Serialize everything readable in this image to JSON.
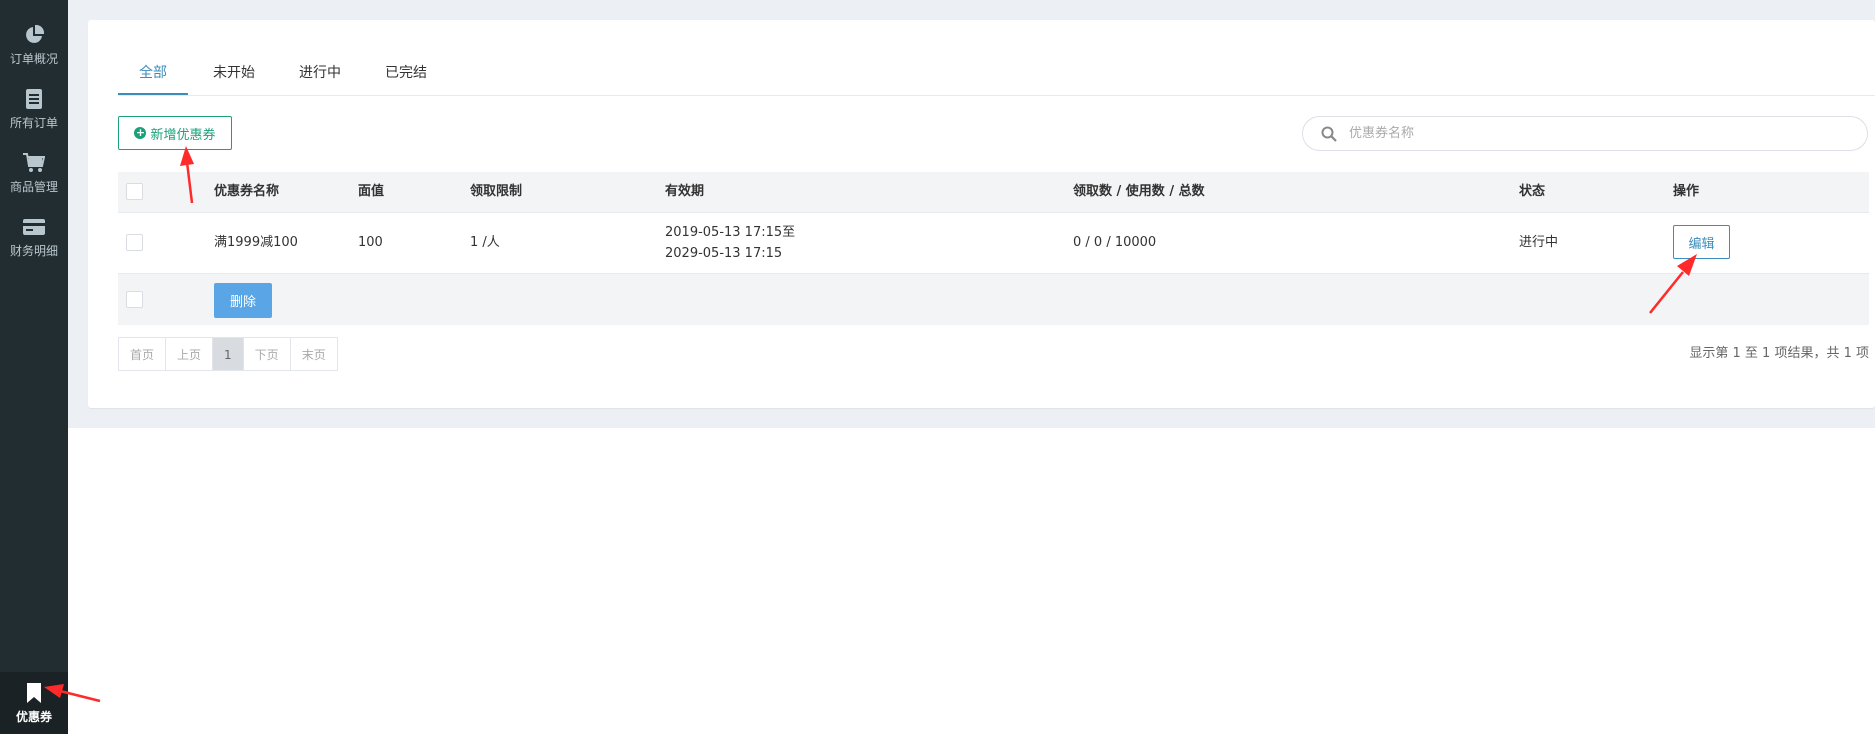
{
  "sidebar": {
    "items": [
      {
        "label": "订单概况",
        "icon": "pie-chart-icon"
      },
      {
        "label": "所有订单",
        "icon": "document-icon"
      },
      {
        "label": "商品管理",
        "icon": "cart-icon"
      },
      {
        "label": "财务明细",
        "icon": "credit-card-icon"
      },
      {
        "label": "优惠券",
        "icon": "bookmark-icon"
      }
    ],
    "active": "优惠券"
  },
  "tabs": [
    {
      "label": "全部",
      "active": true
    },
    {
      "label": "未开始",
      "active": false
    },
    {
      "label": "进行中",
      "active": false
    },
    {
      "label": "已完结",
      "active": false
    }
  ],
  "toolbar": {
    "add_label": "新增优惠券",
    "search_placeholder": "优惠券名称"
  },
  "table": {
    "headers": [
      "优惠券名称",
      "面值",
      "领取限制",
      "有效期",
      "领取数 / 使用数 / 总数",
      "状态",
      "操作"
    ],
    "rows": [
      {
        "name": "满1999减100",
        "value": "100",
        "limit": "1 /人",
        "validity_start": "2019-05-13 17:15至",
        "validity_end": "2029-05-13 17:15",
        "counts": "0 / 0 / 10000",
        "status": "进行中",
        "action": "编辑"
      }
    ],
    "delete_label": "删除"
  },
  "pagination": {
    "first": "首页",
    "prev": "上页",
    "current": "1",
    "next": "下页",
    "last": "末页",
    "summary": "显示第 1 至 1 项结果，共 1 项"
  },
  "colors": {
    "sidebar_bg": "#222d32",
    "accent_blue": "#3c8dbc",
    "accent_green": "#1aa179",
    "annotation_red": "#ff2a2a"
  }
}
